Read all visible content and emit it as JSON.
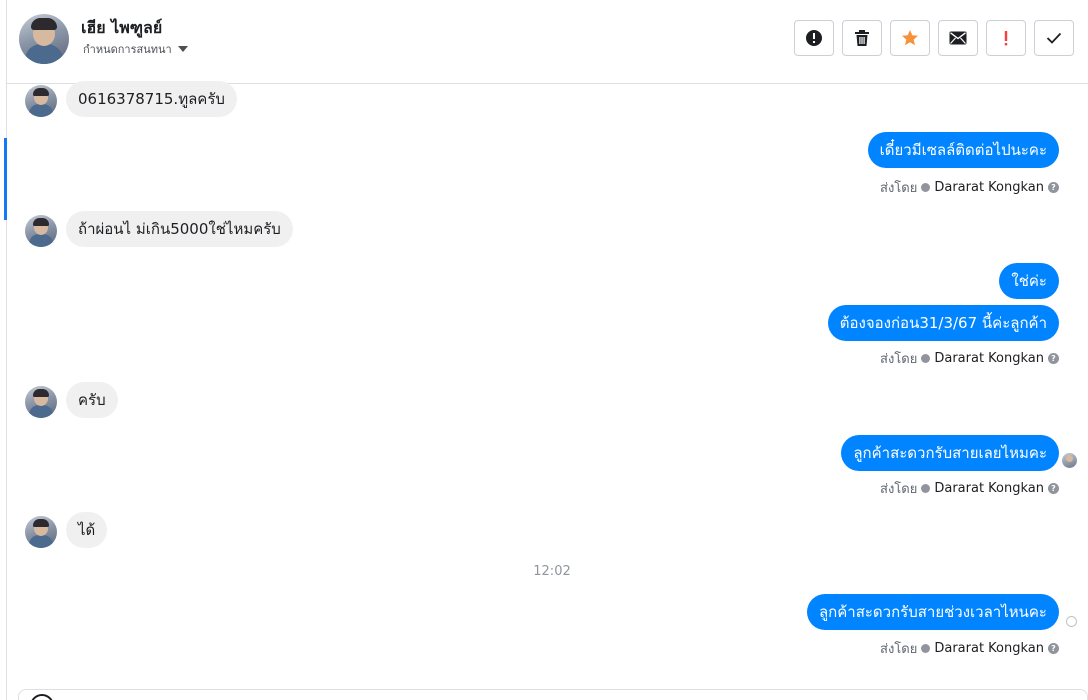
{
  "header": {
    "contact_name": "เฮีย ไพฑูลย์",
    "status_label": "กำหนดการสนทนา",
    "actions": [
      {
        "name": "report-spam",
        "icon": "alert-circle-icon"
      },
      {
        "name": "delete",
        "icon": "trash-icon"
      },
      {
        "name": "star",
        "icon": "star-icon",
        "color": "#f7923b"
      },
      {
        "name": "mark-unread",
        "icon": "envelope-icon"
      },
      {
        "name": "follow-up",
        "icon": "exclamation-icon",
        "color": "#fa3e3e"
      },
      {
        "name": "mark-done",
        "icon": "checkmark-icon"
      }
    ]
  },
  "messages": {
    "m1": "0616378715.ทูลครับ",
    "m2": "เดี๋ยวมีเซลล์ติดต่อไปนะคะ",
    "m3": "ถ้าผ่อนไ ม่เกิน5000ใช่ไหมครับ",
    "m4": "ใช่ค่ะ",
    "m5": "ต้องจองก่อน31/3/67 นี้ค่ะลูกค้า",
    "m6": "ครับ",
    "m7": "ลูกค้าสะดวกรับสายเลยไหมคะ",
    "m8": "ได้",
    "m9": "ลูกค้าสะดวกรับสายช่วงเวลาไหนคะ"
  },
  "sent_by": {
    "prefix": "ส่งโดย",
    "agent": "Dararat Kongkan"
  },
  "timestamp": "12:02",
  "colors": {
    "outgoing_bubble": "#0084ff",
    "incoming_bubble": "#f0f0f0",
    "accent": "#1877f2"
  }
}
